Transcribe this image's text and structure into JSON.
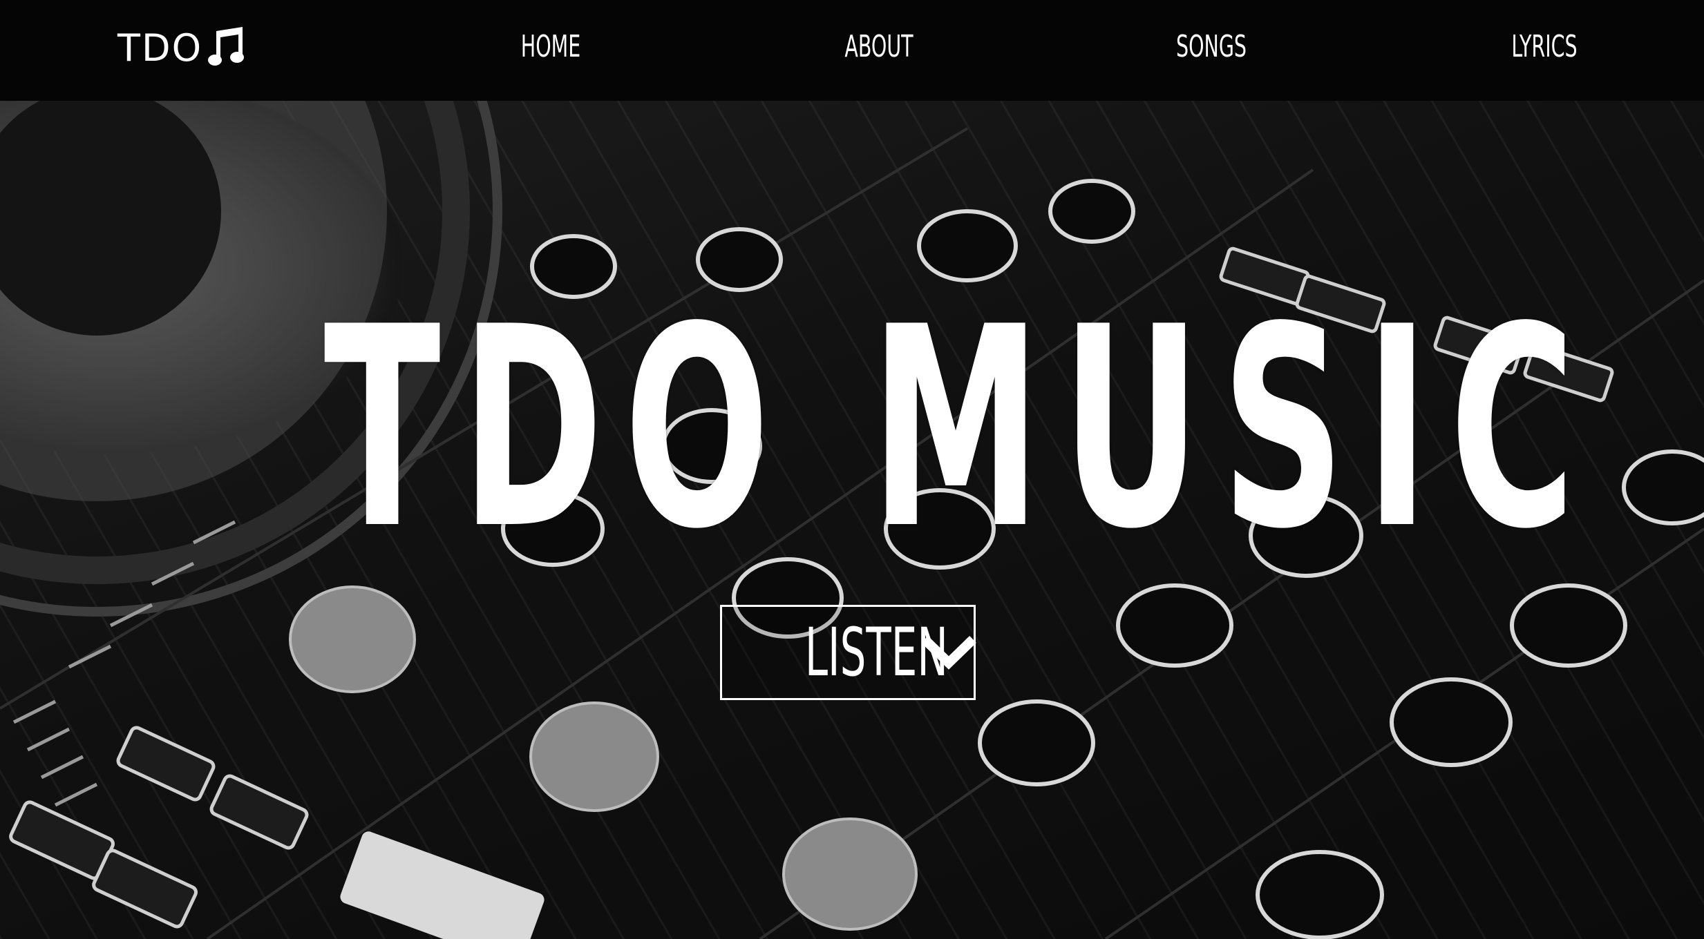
{
  "nav": {
    "brand_text": "TDO",
    "brand_icon": "music-note-icon",
    "links": [
      {
        "label": "HOME"
      },
      {
        "label": "ABOUT"
      },
      {
        "label": "SONGS"
      },
      {
        "label": "LYRICS"
      }
    ]
  },
  "hero": {
    "title": "TDO MUSIC",
    "listen_button": {
      "label": "LISTEN",
      "icon": "chevron-down-icon"
    },
    "background": "dj-mixer-photo"
  },
  "colors": {
    "nav_bg": "#050505",
    "text": "#ffffff",
    "hero_bg": "#111111"
  }
}
